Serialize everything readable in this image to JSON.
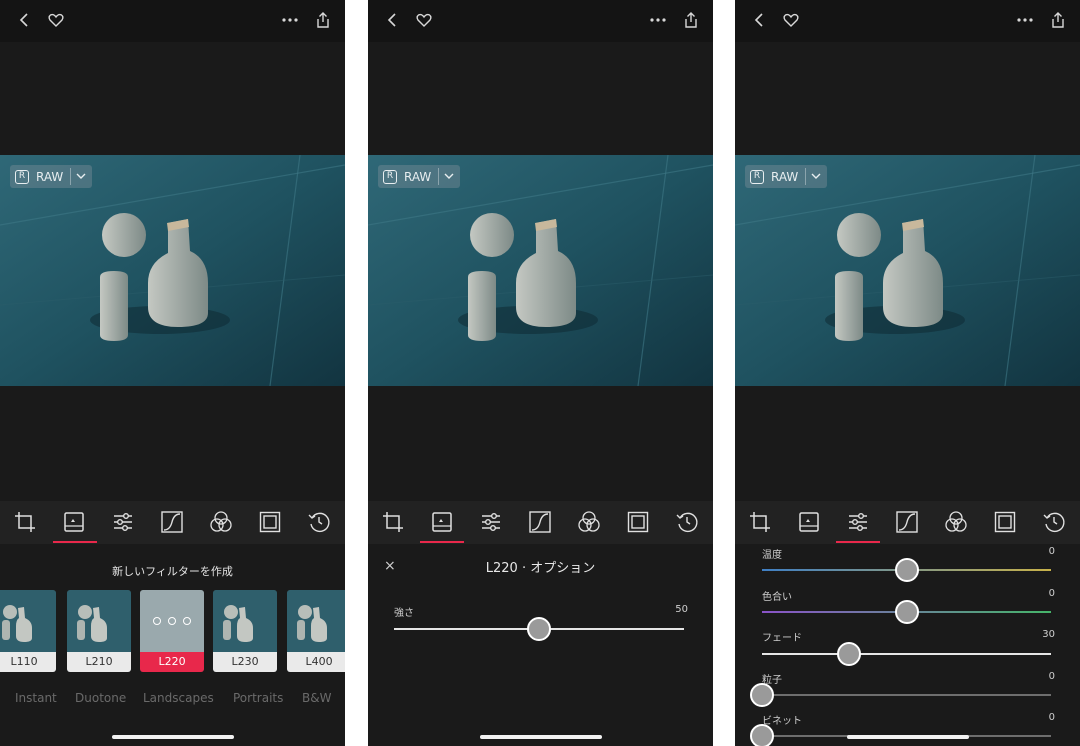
{
  "screens": [
    {
      "raw_label": "RAW",
      "active_tool": "filters"
    },
    {
      "raw_label": "RAW",
      "active_tool": "filters"
    },
    {
      "raw_label": "RAW",
      "active_tool": "adjust"
    }
  ],
  "filter_panel": {
    "title": "新しいフィルターを作成",
    "filters": [
      "L110",
      "L210",
      "L220",
      "L230",
      "L400"
    ],
    "selected": "L220",
    "categories": [
      "Instant",
      "Duotone",
      "Landscapes",
      "Portraits",
      "B&W"
    ]
  },
  "options_panel": {
    "close_symbol": "×",
    "title": "L220 · オプション",
    "slider": {
      "label": "強さ",
      "value": "50",
      "fraction": 0.5
    }
  },
  "adjust_panel": {
    "sliders": [
      {
        "label": "温度",
        "value": "0",
        "fraction": 0.5
      },
      {
        "label": "色合い",
        "value": "0",
        "fraction": 0.5
      },
      {
        "label": "フェード",
        "value": "30",
        "fraction": 0.3
      },
      {
        "label": "粒子",
        "value": "0",
        "fraction": 0.0
      },
      {
        "label": "ビネット",
        "value": "0",
        "fraction": 0.0
      }
    ]
  },
  "icons": [
    "back-chevron-icon",
    "heart-icon",
    "more-icon",
    "share-icon",
    "crop-icon",
    "filter-icon",
    "adjust-sliders-icon",
    "curve-icon",
    "color-mix-icon",
    "frame-icon",
    "history-icon"
  ],
  "colors": {
    "accent": "#e8284b",
    "background": "#1a1a1a",
    "toolbar": "#222222"
  }
}
